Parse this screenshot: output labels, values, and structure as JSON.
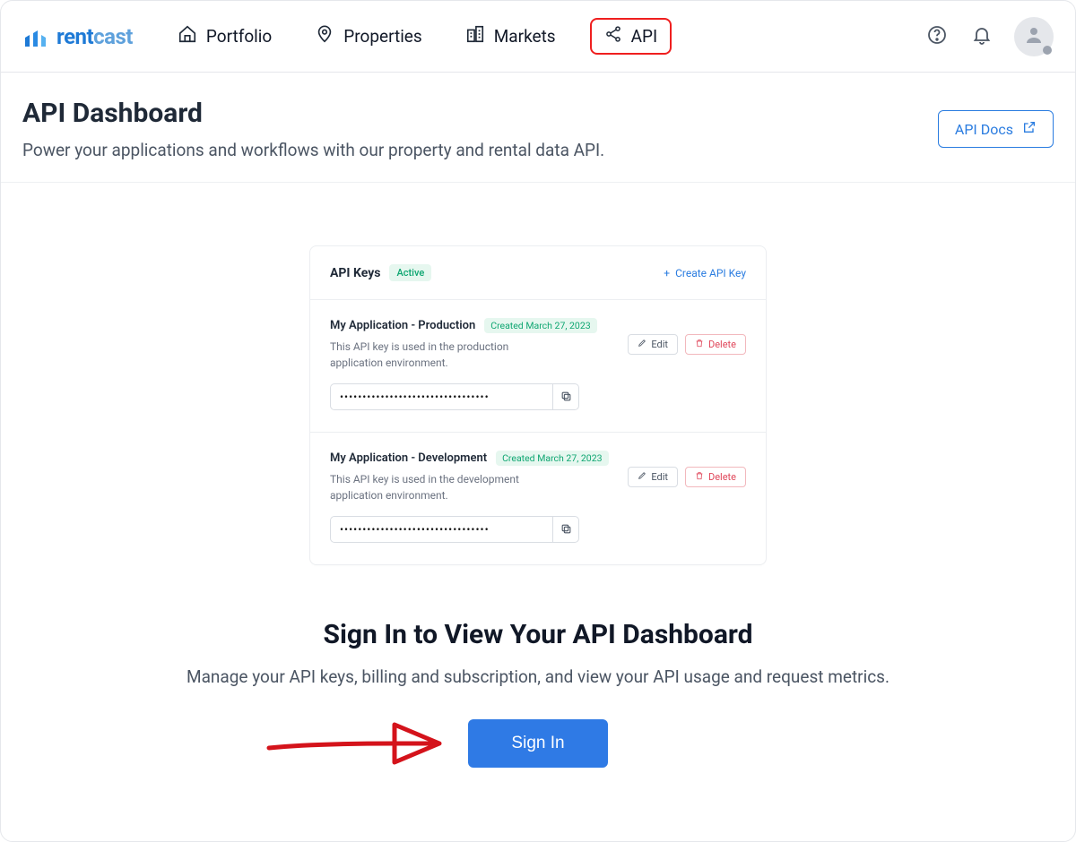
{
  "brand": {
    "rent": "rent",
    "cast": "cast"
  },
  "nav": {
    "portfolio": "Portfolio",
    "properties": "Properties",
    "markets": "Markets",
    "api": "API"
  },
  "header": {
    "title": "API Dashboard",
    "subtitle": "Power your applications and workflows with our property and rental data API.",
    "api_docs": "API Docs"
  },
  "card": {
    "title": "API Keys",
    "status_badge": "Active",
    "create_label": "Create API Key",
    "keys": [
      {
        "name": "My Application - Production",
        "created": "Created March 27, 2023",
        "desc": "This API key is used in the production application environment.",
        "masked": "•••••••••••••••••••••••••••••••••",
        "edit": "Edit",
        "delete": "Delete"
      },
      {
        "name": "My Application - Development",
        "created": "Created March 27, 2023",
        "desc": "This API key is used in the development application environment.",
        "masked": "•••••••••••••••••••••••••••••••••",
        "edit": "Edit",
        "delete": "Delete"
      }
    ]
  },
  "signin": {
    "title": "Sign In to View Your API Dashboard",
    "subtitle": "Manage your API keys, billing and subscription, and view your API usage and request metrics.",
    "button": "Sign In"
  }
}
